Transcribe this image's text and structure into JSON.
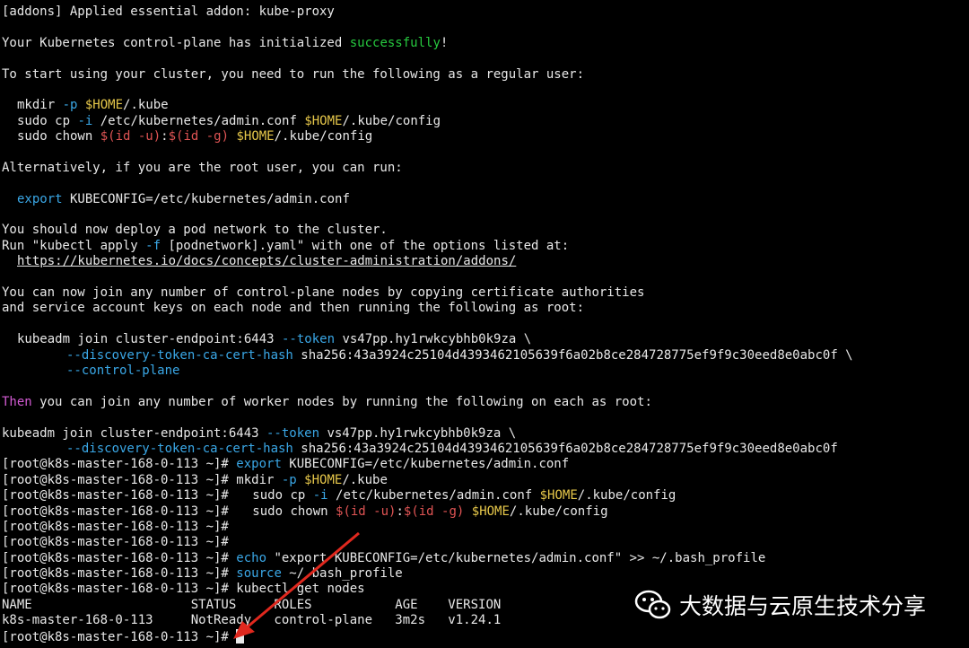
{
  "colors": {
    "background": "#000000",
    "text": "#e8e8e8",
    "success": "#27c93f",
    "option": "#3aa7e6",
    "variable": "#e6c74a",
    "subshell": "#e05454",
    "keyword": "#d35bd3",
    "arrow": "#e0281e"
  },
  "lines": {
    "addons": "[addons] Applied essential addon: kube-proxy",
    "init_pre": "Your Kubernetes control-plane has initialized ",
    "init_ok": "successfully",
    "init_post": "!",
    "start": "To start using your cluster, you need to run the following as a regular user:",
    "mkdir": "mkdir",
    "opt_p": " -p ",
    "home": "$HOME",
    "kube_dir": "/.kube",
    "sudo_cp": "sudo cp",
    "opt_i": " -i ",
    "cp_src": "/etc/kubernetes/admin.conf ",
    "kube_config": "/.kube/config",
    "sudo_chown": "sudo chown ",
    "id_u": "$(id -u)",
    "colon": ":",
    "id_g": "$(id -g)",
    "space": " ",
    "alt": "Alternatively, if you are the root user, you can run:",
    "export_kw": "export",
    "export_rest": " KUBECONFIG=/etc/kubernetes/admin.conf",
    "deploy": "You should now deploy a pod network to the cluster.",
    "run_pre": "Run \"kubectl apply",
    "opt_f": " -f ",
    "run_post": "[podnetwork].yaml\" with one of the options listed at:",
    "url": "https://kubernetes.io/docs/concepts/cluster-administration/addons/",
    "join_cp1": "You can now join any number of control-plane nodes by copying certificate authorities",
    "join_cp2": "and service account keys on each node and then running the following as root:",
    "kjoin": "kubeadm join cluster-endpoint:6443",
    "opt_token": " --token ",
    "token": "vs47pp.hy1rwkcybhb0k9za \\",
    "opt_hash": "--discovery-token-ca-cert-hash",
    "hash": " sha256:43a3924c25104d4393462105639f6a02b8ce284728775ef9f9c30eed8e0abc0f \\",
    "hash_last": " sha256:43a3924c25104d4393462105639f6a02b8ce284728775ef9f9c30eed8e0abc0f",
    "opt_cp": "--control-plane",
    "then": "Then",
    "then_rest": " you can join any number of worker nodes by running the following on each as root:",
    "prompt": "[root@k8s-master-168-0-113 ~]# ",
    "echo_kw": "echo",
    "echo_rest": " \"export KUBECONFIG=/etc/kubernetes/admin.conf\" >> ~/.bash_profile",
    "source_kw": "source",
    "source_rest": " ~/.bash_profile",
    "get_nodes": "kubectl get nodes",
    "table_header": "NAME                     STATUS     ROLES           AGE    VERSION",
    "table_row": "k8s-master-168-0-113     NotReady   control-plane   3m2s   v1.24.1"
  },
  "watermark": {
    "icon": "wechat-icon",
    "text": "大数据与云原生技术分享"
  }
}
